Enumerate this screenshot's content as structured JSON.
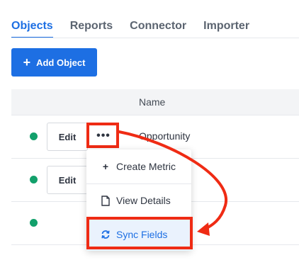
{
  "tabs": [
    {
      "label": "Objects",
      "active": true
    },
    {
      "label": "Reports",
      "active": false
    },
    {
      "label": "Connector",
      "active": false
    },
    {
      "label": "Importer",
      "active": false
    }
  ],
  "toolbar": {
    "add_object_label": "Add Object"
  },
  "table": {
    "header_name": "Name",
    "rows": [
      {
        "edit_label": "Edit",
        "more_label": "•••",
        "name": "Opportunity",
        "status_color": "#12a06b"
      },
      {
        "edit_label": "Edit",
        "name": "",
        "status_color": "#12a06b"
      },
      {
        "name": "",
        "status_color": "#12a06b"
      }
    ]
  },
  "menu": {
    "items": [
      {
        "label": "Create Metric",
        "icon": "plus-icon"
      },
      {
        "label": "View Details",
        "icon": "document-icon"
      },
      {
        "label": "Sync Fields",
        "icon": "sync-icon"
      }
    ]
  },
  "colors": {
    "accent": "#1d6fe3",
    "status": "#12a06b",
    "highlight": "#ef2b14"
  }
}
